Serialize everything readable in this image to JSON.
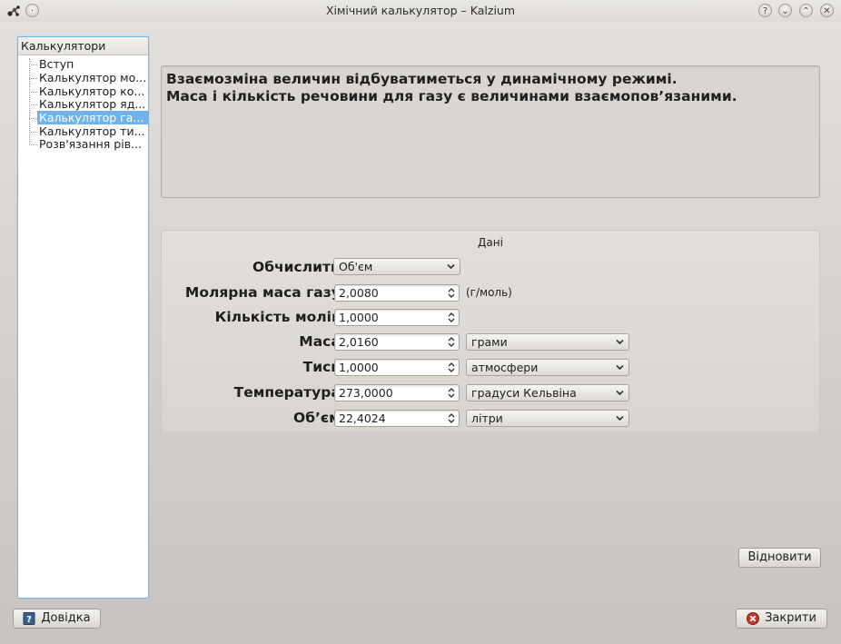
{
  "window": {
    "title": "Хімічний калькулятор – Kalzium",
    "controls": {
      "help": "?",
      "minimize": "⌄",
      "maximize": "⌃",
      "close": "✕",
      "pin": "·"
    }
  },
  "nav": {
    "header": "Калькулятори",
    "items": [
      {
        "label": "Вступ",
        "selected": false
      },
      {
        "label": "Калькулятор мо...",
        "selected": false
      },
      {
        "label": "Калькулятор ко...",
        "selected": false
      },
      {
        "label": "Калькулятор яд...",
        "selected": false
      },
      {
        "label": "Калькулятор га...",
        "selected": true
      },
      {
        "label": "Калькулятор ти...",
        "selected": false
      },
      {
        "label": "Розв'язання рів...",
        "selected": false
      }
    ]
  },
  "info": {
    "line1": "Взаємозміна величин відбуватиметься у динамічному режимі.",
    "line2": "Маса і кількість речовини для газу є величинами взаємопов’язаними."
  },
  "group": {
    "title": "Дані",
    "calculate": {
      "label": "Обчислити:",
      "value": "Об'єм"
    },
    "molar_mass": {
      "label": "Молярна маса газу:",
      "value": "2,0080",
      "unit": "(г/моль)"
    },
    "moles": {
      "label": "Кількість молів:",
      "value": "1,0000"
    },
    "mass": {
      "label": "Маса:",
      "value": "2,0160",
      "unit": "грами"
    },
    "pressure": {
      "label": "Тиск:",
      "value": "1,0000",
      "unit": "атмосфери"
    },
    "temperature": {
      "label": "Температура:",
      "value": "273,0000",
      "unit": "градуси Кельвіна"
    },
    "volume": {
      "label": "Об’єм:",
      "value": "22,4024",
      "unit": "літри"
    }
  },
  "buttons": {
    "reset": "Відновити",
    "help": "Довідка",
    "close": "Закрити"
  },
  "colors": {
    "selection": "#6eb4ea",
    "focus_border": "#72b5e9",
    "close_icon": "#c0392b"
  }
}
